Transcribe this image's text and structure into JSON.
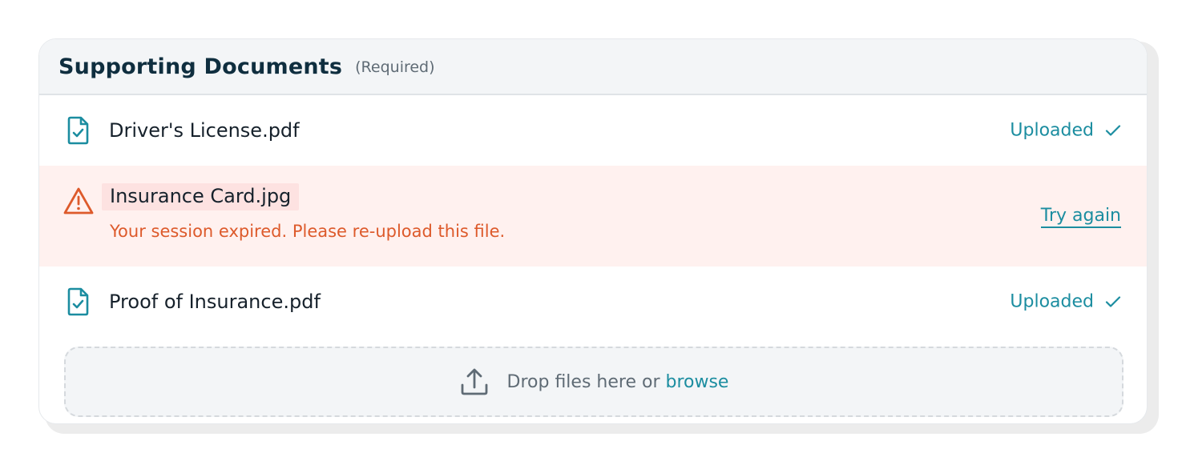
{
  "panel": {
    "title": "Supporting Documents",
    "required_label": "(Required)"
  },
  "files": [
    {
      "name": "Driver's License.pdf",
      "status": "Uploaded",
      "icon": "file-check-icon"
    },
    {
      "name": "Insurance Card.jpg",
      "status": "error",
      "error_message": "Your session expired. Please re-upload this file.",
      "action_label": "Try again",
      "icon": "warning-icon"
    },
    {
      "name": "Proof of Insurance.pdf",
      "status": "Uploaded",
      "icon": "file-check-icon"
    }
  ],
  "dropzone": {
    "text": "Drop files here or",
    "link": "browse",
    "icon": "upload-icon"
  },
  "colors": {
    "accent": "#1b8da0",
    "error": "#dd5a2b",
    "error_bg": "#fff1ef",
    "title": "#0f2e3f"
  }
}
